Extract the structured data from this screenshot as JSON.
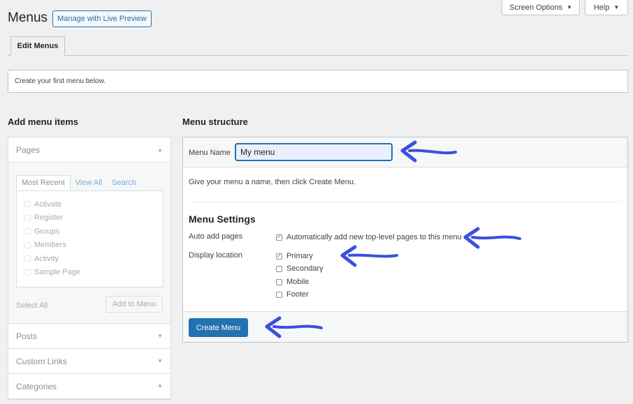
{
  "header": {
    "title": "Menus",
    "live_preview_label": "Manage with Live Preview",
    "screen_options_label": "Screen Options",
    "help_label": "Help"
  },
  "tabs": [
    {
      "label": "Edit Menus"
    }
  ],
  "notice": "Create your first menu below.",
  "add_items": {
    "heading": "Add menu items",
    "pages": {
      "title": "Pages",
      "subtabs": [
        "Most Recent",
        "View All",
        "Search"
      ],
      "items": [
        "Activate",
        "Register",
        "Groups",
        "Members",
        "Activity",
        "Sample Page"
      ],
      "select_all_label": "Select All",
      "add_button_label": "Add to Menu"
    },
    "sections": [
      "Posts",
      "Custom Links",
      "Categories"
    ]
  },
  "structure": {
    "heading": "Menu structure",
    "name_label": "Menu Name",
    "name_value": "My menu",
    "hint": "Give your menu a name, then click Create Menu.",
    "settings_heading": "Menu Settings",
    "auto_add_label": "Auto add pages",
    "auto_add_option": "Automatically add new top-level pages to this menu",
    "auto_add_checked": true,
    "display_location_label": "Display location",
    "locations": [
      {
        "label": "Primary",
        "checked": true
      },
      {
        "label": "Secondary",
        "checked": false
      },
      {
        "label": "Mobile",
        "checked": false
      },
      {
        "label": "Footer",
        "checked": false
      }
    ],
    "create_button_label": "Create Menu"
  },
  "colors": {
    "accent": "#2271b1",
    "annotation_arrow": "#3b4fe0",
    "background": "#f0f0f1"
  }
}
